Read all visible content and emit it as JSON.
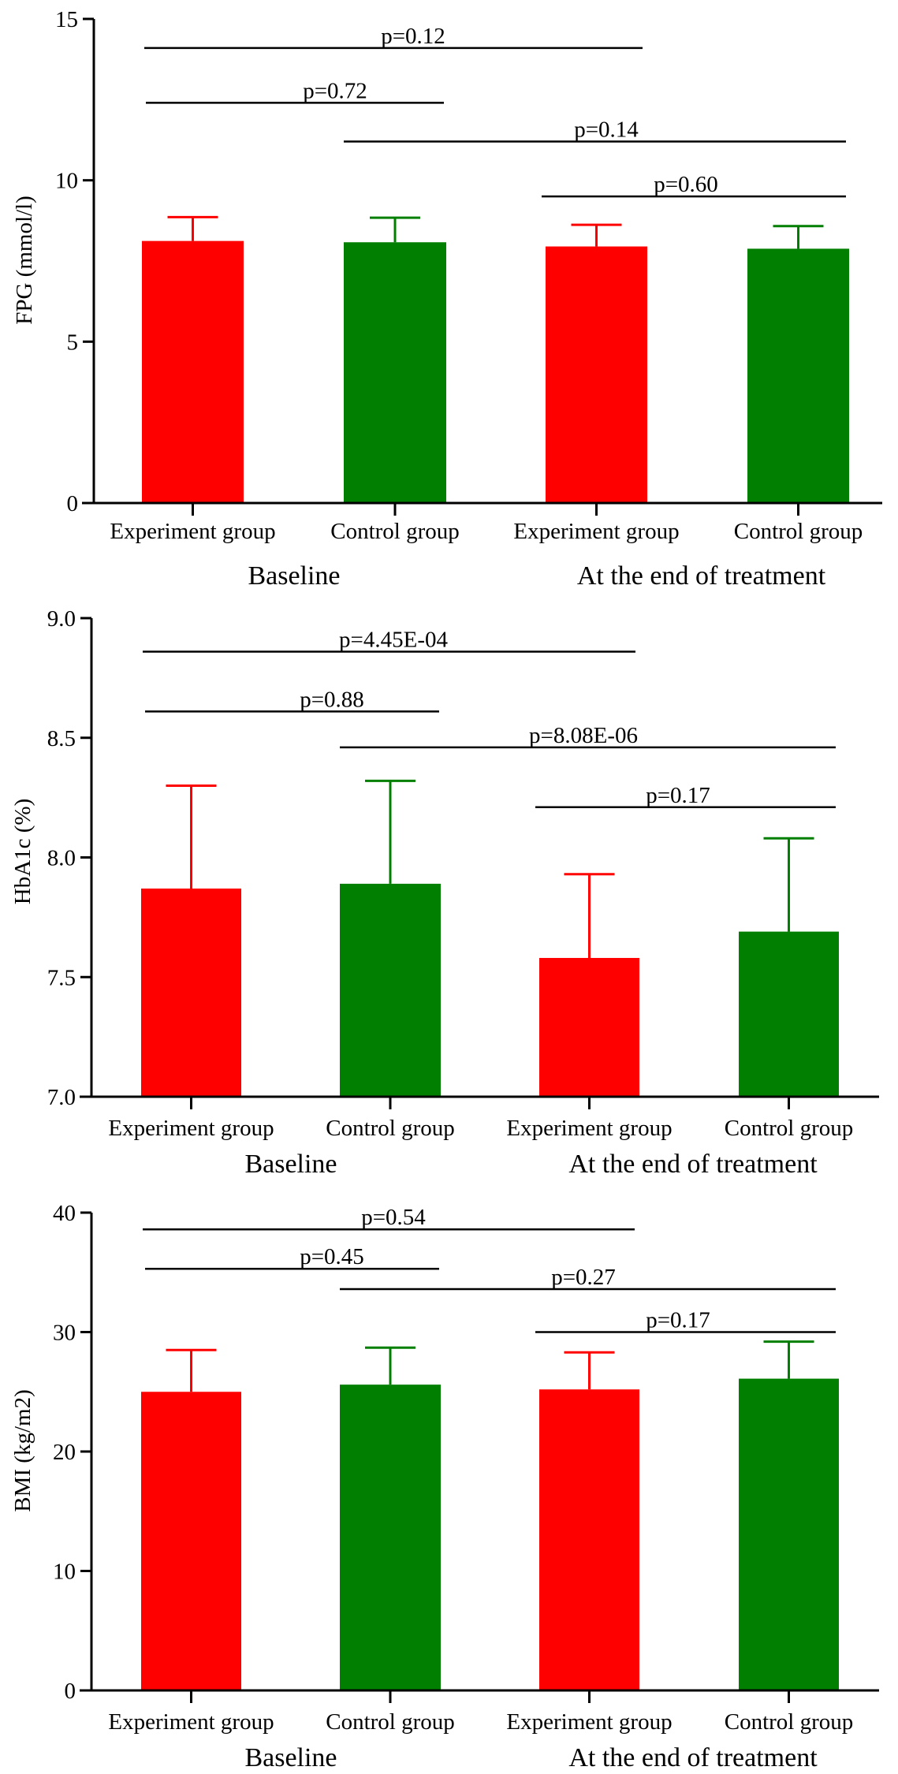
{
  "colors": {
    "experiment": "#ff0000",
    "control": "#007f00",
    "axis": "#000000"
  },
  "chart_data": [
    {
      "type": "bar",
      "id": "fpg",
      "title": "",
      "ylabel": "FPG (mmol/l)",
      "xlabel": "",
      "ylim": [
        0,
        15
      ],
      "yticks": [
        0,
        5,
        10,
        15
      ],
      "ytick_labels": [
        "0",
        "5",
        "10",
        "15"
      ],
      "categories": [
        "Experiment group",
        "Control group",
        "Experiment group",
        "Control group"
      ],
      "groups": [
        {
          "label": "Baseline",
          "categories": [
            0,
            1
          ]
        },
        {
          "label": "At the end of treatment",
          "categories": [
            2,
            3
          ]
        }
      ],
      "bar_colors": [
        "experiment",
        "control",
        "experiment",
        "control"
      ],
      "values": [
        8.12,
        8.08,
        7.95,
        7.88
      ],
      "error_upper": [
        8.86,
        8.84,
        8.62,
        8.58
      ],
      "comparisons": [
        {
          "from": 0,
          "to": 2,
          "label": "p=0.12",
          "level": 14.1
        },
        {
          "from": 0,
          "to": 1,
          "label": "p=0.72",
          "level": 12.4
        },
        {
          "from": 1,
          "to": 3,
          "label": "p=0.14",
          "level": 11.2
        },
        {
          "from": 2,
          "to": 3,
          "label": "p=0.60",
          "level": 9.5
        }
      ],
      "grid": false,
      "legend": "none"
    },
    {
      "type": "bar",
      "id": "hba1c",
      "title": "",
      "ylabel": "HbA1c (%)",
      "xlabel": "",
      "ylim": [
        7.0,
        9.0
      ],
      "yticks": [
        7.0,
        7.5,
        8.0,
        8.5,
        9.0
      ],
      "ytick_labels": [
        "7.0",
        "7.5",
        "8.0",
        "8.5",
        "9.0"
      ],
      "categories": [
        "Experiment group",
        "Control group",
        "Experiment group",
        "Control group"
      ],
      "groups": [
        {
          "label": "Baseline",
          "categories": [
            0,
            1
          ]
        },
        {
          "label": "At the end of treatment",
          "categories": [
            2,
            3
          ]
        }
      ],
      "bar_colors": [
        "experiment",
        "control",
        "experiment",
        "control"
      ],
      "values": [
        7.87,
        7.89,
        7.58,
        7.69
      ],
      "error_upper": [
        8.3,
        8.32,
        7.93,
        8.08
      ],
      "comparisons": [
        {
          "from": 0,
          "to": 2,
          "label": "p=4.45E-04",
          "level": 8.86
        },
        {
          "from": 0,
          "to": 1,
          "label": "p=0.88",
          "level": 8.61
        },
        {
          "from": 1,
          "to": 3,
          "label": "p=8.08E-06",
          "level": 8.46
        },
        {
          "from": 2,
          "to": 3,
          "label": "p=0.17",
          "level": 8.21
        }
      ],
      "grid": false,
      "legend": "none"
    },
    {
      "type": "bar",
      "id": "bmi",
      "title": "",
      "ylabel": "BMI (kg/m2)",
      "xlabel": "",
      "ylim": [
        0,
        40
      ],
      "yticks": [
        0,
        10,
        20,
        30,
        40
      ],
      "ytick_labels": [
        "0",
        "10",
        "20",
        "30",
        "40"
      ],
      "categories": [
        "Experiment group",
        "Control group",
        "Experiment group",
        "Control group"
      ],
      "groups": [
        {
          "label": "Baseline",
          "categories": [
            0,
            1
          ]
        },
        {
          "label": "At the end of treatment",
          "categories": [
            2,
            3
          ]
        }
      ],
      "bar_colors": [
        "experiment",
        "control",
        "experiment",
        "control"
      ],
      "values": [
        25.0,
        25.6,
        25.2,
        26.1
      ],
      "error_upper": [
        28.5,
        28.7,
        28.3,
        29.2
      ],
      "comparisons": [
        {
          "from": 0,
          "to": 2,
          "label": "p=0.54",
          "level": 38.6
        },
        {
          "from": 0,
          "to": 1,
          "label": "p=0.45",
          "level": 35.3
        },
        {
          "from": 1,
          "to": 3,
          "label": "p=0.27",
          "level": 33.6
        },
        {
          "from": 2,
          "to": 3,
          "label": "p=0.17",
          "level": 30.0
        }
      ],
      "grid": false,
      "legend": "none"
    }
  ]
}
